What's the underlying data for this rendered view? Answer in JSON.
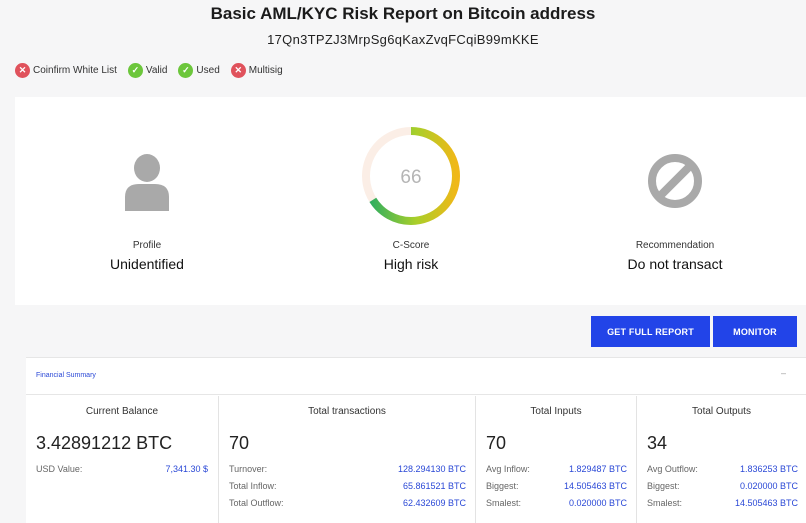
{
  "header": {
    "title": "Basic AML/KYC Risk Report on Bitcoin address",
    "address": "17Qn3TPZJ3MrpSg6qKaxZvqFCqiB99mKKE"
  },
  "badges": [
    {
      "label": "Coinfirm White List",
      "status": "negative",
      "icon": "x-circle-icon"
    },
    {
      "label": "Valid",
      "status": "positive",
      "icon": "check-circle-icon"
    },
    {
      "label": "Used",
      "status": "positive",
      "icon": "check-circle-icon"
    },
    {
      "label": "Multisig",
      "status": "negative",
      "icon": "x-circle-icon"
    }
  ],
  "summary": {
    "profile": {
      "label": "Profile",
      "value": "Unidentified",
      "icon": "user-icon"
    },
    "cscore": {
      "label": "C-Score",
      "value": "High risk",
      "score": "66",
      "score_fraction": 0.66,
      "icon": "gauge-icon"
    },
    "recommendation": {
      "label": "Recommendation",
      "value": "Do not transact",
      "icon": "prohibited-icon"
    }
  },
  "actions": {
    "full_report": "GET FULL REPORT",
    "monitor": "MONITOR"
  },
  "financial": {
    "section_title": "Financial Summary",
    "collapse": "–",
    "balance": {
      "heading": "Current Balance",
      "value": "3.42891212 BTC",
      "usd_label": "USD Value:",
      "usd_value": "7,341.30 $"
    },
    "transactions": {
      "heading": "Total transactions",
      "value": "70",
      "rows": [
        {
          "k": "Turnover:",
          "v": "128.294130 BTC"
        },
        {
          "k": "Total Inflow:",
          "v": "65.861521 BTC"
        },
        {
          "k": "Total Outflow:",
          "v": "62.432609 BTC"
        }
      ]
    },
    "inputs": {
      "heading": "Total Inputs",
      "value": "70",
      "rows": [
        {
          "k": "Avg Inflow:",
          "v": "1.829487 BTC"
        },
        {
          "k": "Biggest:",
          "v": "14.505463 BTC"
        },
        {
          "k": "Smalest:",
          "v": "0.020000 BTC"
        }
      ]
    },
    "outputs": {
      "heading": "Total Outputs",
      "value": "34",
      "rows": [
        {
          "k": "Avg Outflow:",
          "v": "1.836253 BTC"
        },
        {
          "k": "Biggest:",
          "v": "0.020000 BTC"
        },
        {
          "k": "Smalest:",
          "v": "14.505463 BTC"
        }
      ]
    }
  },
  "colors": {
    "accent": "#2244e8",
    "negative": "#e0525c",
    "positive": "#6cc63b",
    "link": "#2a48d6"
  }
}
